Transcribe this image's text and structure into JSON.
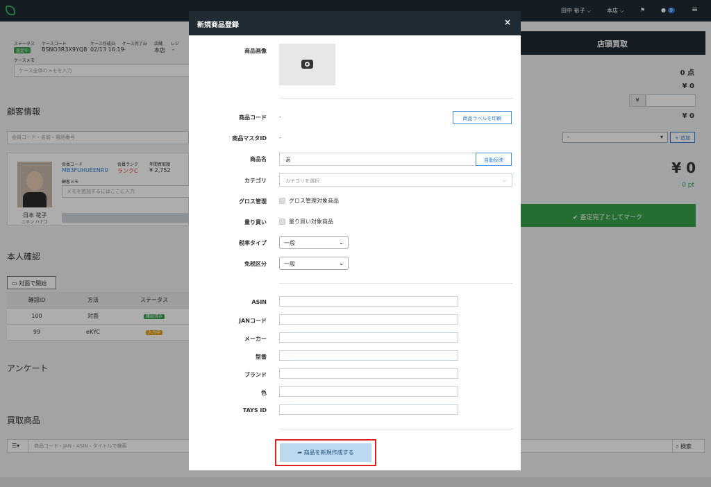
{
  "topbar": {
    "user": "田中 裕子 ⌵",
    "store": "本店 ⌵",
    "chat_count": "9"
  },
  "case": {
    "headers": [
      "ステータス",
      "ケースコード",
      "ケース作成日",
      "ケース完了日",
      "店舗",
      "レジ"
    ],
    "status_badge": "査定中",
    "code": "BSNO3R3X9YQ8",
    "created": "02/13 16:19",
    "completed": "-",
    "store": "本店",
    "register": "-",
    "memo_label": "ケースメモ",
    "memo_placeholder": "ケース全体のメモを入力"
  },
  "customer": {
    "title": "顧客情報",
    "search_placeholder": "会員コード・名前・電話番号",
    "member_code_label": "会員コード",
    "member_code": "MB3FUHUEENR0",
    "rank_label": "会員ランク",
    "rank": "ランクC",
    "yearly_label": "年間買取額",
    "yearly": "¥ 2,752",
    "memo_label": "顧客メモ",
    "memo_placeholder": "メモを追加するにはここに入力",
    "name": "日本 花子",
    "kana": "ニホン ハナコ"
  },
  "identity": {
    "title": "本人確認",
    "start_button": "対面で開始",
    "columns": [
      "確認ID",
      "方法",
      "ステータス"
    ],
    "rows": [
      {
        "id": "100",
        "method": "対面",
        "status": "確認済み"
      },
      {
        "id": "99",
        "method": "eKYC",
        "status": "入力中"
      }
    ]
  },
  "survey": {
    "title": "アンケート"
  },
  "purchase": {
    "title": "買取商品",
    "search_placeholder": "商品コード・JAN・ASIN・タイトルで検索",
    "search_button": "検索"
  },
  "right_panel": {
    "header": "店頭買取",
    "count": "0 点",
    "amount1": "¥ 0",
    "yen": "¥",
    "amount2": "¥ 0",
    "select_value": "-",
    "add_button": "+ 追加",
    "total": "¥ 0",
    "points": "0 pt",
    "complete_button": "✔ 査定完了としてマーク"
  },
  "modal": {
    "title": "新規商品登録",
    "close": "×",
    "labels": {
      "image": "商品画像",
      "code": "商品コード",
      "master_id": "商品マスタID",
      "name": "商品名",
      "category": "カテゴリ",
      "gross": "グロス管理",
      "bulk": "量り買い",
      "tax_type": "税率タイプ",
      "tax_free": "免税区分",
      "asin": "ASIN",
      "jan": "JANコード",
      "maker": "メーカー",
      "model": "型番",
      "brand": "ブランド",
      "color": "色",
      "tays_id": "TAYS ID"
    },
    "values": {
      "code": "-",
      "master_id": "-",
      "name": "あ",
      "category_placeholder": "カテゴリを選択",
      "gross_check": "グロス管理対象商品",
      "bulk_check": "量り買い対象商品",
      "tax_type": "一般",
      "tax_free": "一般"
    },
    "print_label_button": "商品ラベルを印刷",
    "auto_reflect_button": "自動反映",
    "submit_button": "商品を新規作成する"
  },
  "colors": {
    "topbar": "#1f2a33",
    "accent_blue": "#2b7cd6",
    "green": "#37a24a",
    "highlight": "#e02020"
  }
}
